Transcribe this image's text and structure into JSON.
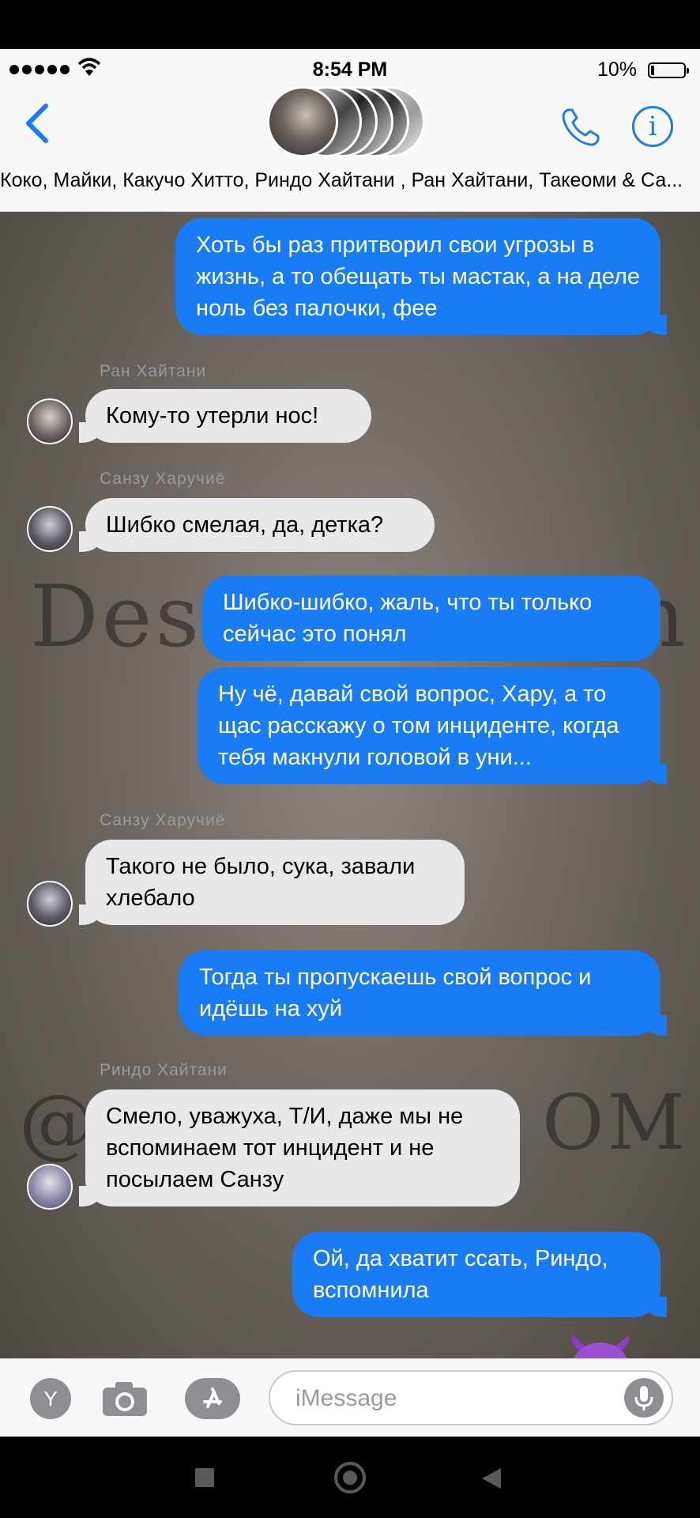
{
  "status_bar": {
    "time": "8:54 PM",
    "battery": "10%"
  },
  "header": {
    "group_names": "Коко, Майки, Какучо Хитто, Риндо Хайтани , Ран Хайтани, Такеоми & Са..."
  },
  "watermark": {
    "line1": "Des",
    "line1_right": "n",
    "line2_left": "@",
    "line2_right": "OM"
  },
  "messages": [
    {
      "type": "sent",
      "text": "Хоть бы раз притворил свои угрозы в жизнь, а то обещать ты мастак, а на деле ноль без палочки, фее"
    },
    {
      "type": "received",
      "sender": "Ран Хайтани",
      "text": "Кому-то утерли нос!"
    },
    {
      "type": "received",
      "sender": "Санзу Харучиё",
      "text": "Шибко смелая, да, детка?"
    },
    {
      "type": "sent",
      "text": "Шибко-шибко, жаль, что ты только сейчас это понял"
    },
    {
      "type": "sent",
      "text": "Ну чё, давай свой вопрос, Хару, а то щас расскажу о том инциденте, когда тебя макнули головой в уни..."
    },
    {
      "type": "received",
      "sender": "Санзу Харучиё",
      "text": "Такого не было, сука, завали хлебало"
    },
    {
      "type": "sent",
      "text": "Тогда ты пропускаешь свой вопрос и идёшь на хуй"
    },
    {
      "type": "received",
      "sender": "Риндо Хайтани",
      "text": "Смело, уважуха, Т/И, даже мы не вспоминаем тот инцидент и не посылаем Санзу"
    },
    {
      "type": "sent",
      "text": "Ой, да хватит ссать, Риндо, вспомнила"
    }
  ],
  "input_bar": {
    "app_button": "Y",
    "placeholder": "iMessage"
  },
  "icons": [
    "back-chevron-icon",
    "phone-icon",
    "info-icon",
    "camera-icon",
    "app-store-icon",
    "microphone-icon",
    "devil-emoji-icon"
  ],
  "colors": {
    "sent_bubble": "#1a7cf5",
    "received_bubble": "#e8e8ea",
    "accent": "#1a7cf5"
  }
}
